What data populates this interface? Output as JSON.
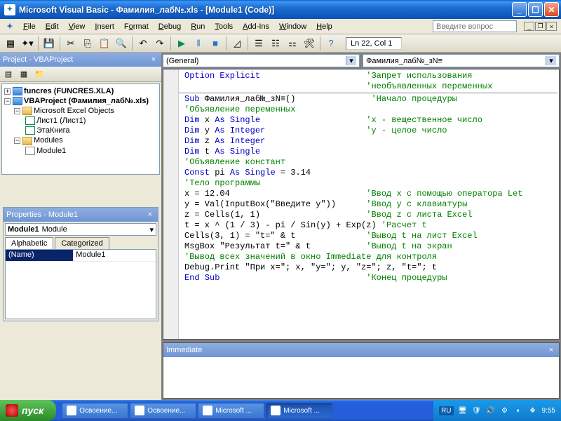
{
  "window": {
    "title": "Microsoft Visual Basic - Фамилия_лаб№.xls - [Module1 (Code)]"
  },
  "menu": {
    "file": "File",
    "edit": "Edit",
    "view": "View",
    "insert": "Insert",
    "format": "Format",
    "debug": "Debug",
    "run": "Run",
    "tools": "Tools",
    "addins": "Add-Ins",
    "window": "Window",
    "help": "Help",
    "question_placeholder": "Введите вопрос"
  },
  "toolbar": {
    "status": "Ln 22, Col 1"
  },
  "project": {
    "title": "Project - VBAProject",
    "tree": {
      "funcres": "funcres (FUNCRES.XLA)",
      "vbaproject": "VBAProject (Фамилия_лаб№.xls)",
      "excel_objects": "Microsoft Excel Objects",
      "sheet1": "Лист1 (Лист1)",
      "thisbook": "ЭтаКнига",
      "modules": "Modules",
      "module1": "Module1"
    }
  },
  "properties": {
    "title": "Properties - Module1",
    "selector_name": "Module1",
    "selector_type": "Module",
    "tab_alpha": "Alphabetic",
    "tab_cat": "Categorized",
    "name_label": "(Name)",
    "name_value": "Module1"
  },
  "code": {
    "dd_left": "(General)",
    "dd_right": "Фамилия_лаб№_зN≡",
    "lines": [
      {
        "t": "code",
        "c": "<kw>Option Explicit</kw>                     <cm>'Запрет использования</cm>"
      },
      {
        "t": "code",
        "c": "                                    <cm>'необъявленных переменных</cm>"
      },
      {
        "t": "hr"
      },
      {
        "t": "code",
        "c": "<kw>Sub</kw> Фамилия_лаб№_зN≡()               <cm>'Начало процедуры</cm>"
      },
      {
        "t": "code",
        "c": "<cm>'Объявление переменных</cm>"
      },
      {
        "t": "code",
        "c": "<kw>Dim</kw> x <kw>As Single</kw>                     <cm>'x - вещественное число</cm>"
      },
      {
        "t": "code",
        "c": "<kw>Dim</kw> y <kw>As Integer</kw>                    <cm>'y - целое число</cm>"
      },
      {
        "t": "code",
        "c": "<kw>Dim</kw> z <kw>As Integer</kw>"
      },
      {
        "t": "code",
        "c": "<kw>Dim</kw> t <kw>As Single</kw>"
      },
      {
        "t": "code",
        "c": "<cm>'Объявление констант</cm>"
      },
      {
        "t": "code",
        "c": "<kw>Const</kw> pi <kw>As Single</kw> = 3.14"
      },
      {
        "t": "code",
        "c": "<cm>'Тело программы</cm>"
      },
      {
        "t": "code",
        "c": "x = 12.04                           <cm>'Ввод x с помощью оператора Let</cm>"
      },
      {
        "t": "code",
        "c": "y = Val(InputBox(\"Введите y\"))      <cm>'Ввод y с клавиатуры</cm>"
      },
      {
        "t": "code",
        "c": "z = Cells(1, 1)                     <cm>'Ввод z с листа Excel</cm>"
      },
      {
        "t": "code",
        "c": "t = x ^ (1 / 3) - pi / Sin(y) + Exp(z) <cm>'Расчет t</cm>"
      },
      {
        "t": "code",
        "c": "Cells(3, 1) = \"t=\" & t              <cm>'Вывод t на лист Excel</cm>"
      },
      {
        "t": "code",
        "c": "MsgBox \"Результат t=\" & t           <cm>'Вывод t на экран</cm>"
      },
      {
        "t": "code",
        "c": "<cm>'Вывод всех значений в окно Immediate для контроля</cm>"
      },
      {
        "t": "code",
        "c": "Debug.Print \"При x=\"; x, \"y=\"; y, \"z=\"; z, \"t=\"; t"
      },
      {
        "t": "code",
        "c": "<kw>End Sub</kw>                             <cm>'Конец процедуры</cm>"
      }
    ]
  },
  "immediate": {
    "title": "Immediate"
  },
  "taskbar": {
    "start": "пуск",
    "tasks": [
      {
        "label": "Освоение..."
      },
      {
        "label": "Освоение..."
      },
      {
        "label": "Microsoft ..."
      },
      {
        "label": "Microsoft ...",
        "active": true
      }
    ],
    "lang": "RU",
    "time": "9:55"
  }
}
